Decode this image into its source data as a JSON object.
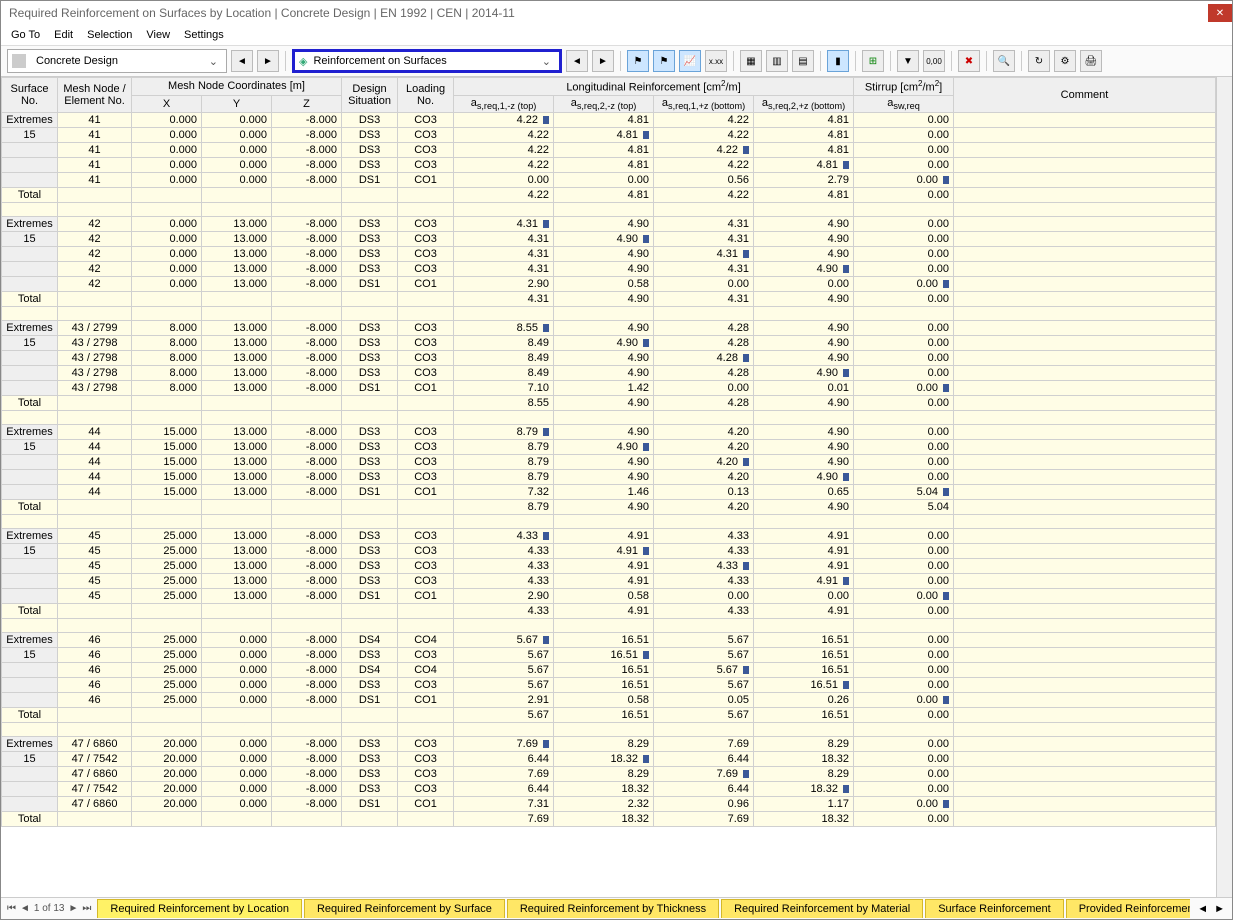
{
  "title": "Required Reinforcement on Surfaces by Location | Concrete Design | EN 1992 | CEN | 2014-11",
  "menu": [
    "Go To",
    "Edit",
    "Selection",
    "View",
    "Settings"
  ],
  "combo_design": "Concrete Design",
  "combo_reinf": "Reinforcement on Surfaces",
  "headers": {
    "surface_no": "Surface\nNo.",
    "mesh_node": "Mesh Node /\nElement No.",
    "coords": "Mesh Node Coordinates [m]",
    "x": "X",
    "y": "Y",
    "z": "Z",
    "design_sit": "Design\nSituation",
    "loading_no": "Loading\nNo.",
    "long_reinf": "Longitudinal Reinforcement [cm²/m]",
    "c1": "a_s,req,1,-z (top)",
    "c2": "a_s,req,2,-z (top)",
    "c3": "a_s,req,1,+z (bottom)",
    "c4": "a_s,req,2,+z (bottom)",
    "stirrup": "Stirrup [cm²/m²]",
    "sw": "a_sw,req",
    "comment": "Comment"
  },
  "groups": [
    {
      "label1": "Extremes",
      "label2": "15",
      "rows": [
        {
          "mn": "41",
          "x": "0.000",
          "y": "0.000",
          "z": "-8.000",
          "ds": "DS3",
          "ln": "CO3",
          "v": [
            "4.22",
            "4.81",
            "4.22",
            "4.81",
            "0.00"
          ],
          "m": [
            1,
            0,
            0,
            0,
            0
          ]
        },
        {
          "mn": "41",
          "x": "0.000",
          "y": "0.000",
          "z": "-8.000",
          "ds": "DS3",
          "ln": "CO3",
          "v": [
            "4.22",
            "4.81",
            "4.22",
            "4.81",
            "0.00"
          ],
          "m": [
            0,
            1,
            0,
            0,
            0
          ]
        },
        {
          "mn": "41",
          "x": "0.000",
          "y": "0.000",
          "z": "-8.000",
          "ds": "DS3",
          "ln": "CO3",
          "v": [
            "4.22",
            "4.81",
            "4.22",
            "4.81",
            "0.00"
          ],
          "m": [
            0,
            0,
            1,
            0,
            0
          ]
        },
        {
          "mn": "41",
          "x": "0.000",
          "y": "0.000",
          "z": "-8.000",
          "ds": "DS3",
          "ln": "CO3",
          "v": [
            "4.22",
            "4.81",
            "4.22",
            "4.81",
            "0.00"
          ],
          "m": [
            0,
            0,
            0,
            1,
            0
          ]
        },
        {
          "mn": "41",
          "x": "0.000",
          "y": "0.000",
          "z": "-8.000",
          "ds": "DS1",
          "ln": "CO1",
          "v": [
            "0.00",
            "0.00",
            "0.56",
            "2.79",
            "0.00"
          ],
          "m": [
            0,
            0,
            0,
            0,
            1
          ]
        }
      ],
      "total": [
        "4.22",
        "4.81",
        "4.22",
        "4.81",
        "0.00"
      ]
    },
    {
      "label1": "Extremes",
      "label2": "15",
      "rows": [
        {
          "mn": "42",
          "x": "0.000",
          "y": "13.000",
          "z": "-8.000",
          "ds": "DS3",
          "ln": "CO3",
          "v": [
            "4.31",
            "4.90",
            "4.31",
            "4.90",
            "0.00"
          ],
          "m": [
            1,
            0,
            0,
            0,
            0
          ]
        },
        {
          "mn": "42",
          "x": "0.000",
          "y": "13.000",
          "z": "-8.000",
          "ds": "DS3",
          "ln": "CO3",
          "v": [
            "4.31",
            "4.90",
            "4.31",
            "4.90",
            "0.00"
          ],
          "m": [
            0,
            1,
            0,
            0,
            0
          ]
        },
        {
          "mn": "42",
          "x": "0.000",
          "y": "13.000",
          "z": "-8.000",
          "ds": "DS3",
          "ln": "CO3",
          "v": [
            "4.31",
            "4.90",
            "4.31",
            "4.90",
            "0.00"
          ],
          "m": [
            0,
            0,
            1,
            0,
            0
          ]
        },
        {
          "mn": "42",
          "x": "0.000",
          "y": "13.000",
          "z": "-8.000",
          "ds": "DS3",
          "ln": "CO3",
          "v": [
            "4.31",
            "4.90",
            "4.31",
            "4.90",
            "0.00"
          ],
          "m": [
            0,
            0,
            0,
            1,
            0
          ]
        },
        {
          "mn": "42",
          "x": "0.000",
          "y": "13.000",
          "z": "-8.000",
          "ds": "DS1",
          "ln": "CO1",
          "v": [
            "2.90",
            "0.58",
            "0.00",
            "0.00",
            "0.00"
          ],
          "m": [
            0,
            0,
            0,
            0,
            1
          ]
        }
      ],
      "total": [
        "4.31",
        "4.90",
        "4.31",
        "4.90",
        "0.00"
      ]
    },
    {
      "label1": "Extremes",
      "label2": "15",
      "rows": [
        {
          "mn": "43 / 2799",
          "x": "8.000",
          "y": "13.000",
          "z": "-8.000",
          "ds": "DS3",
          "ln": "CO3",
          "v": [
            "8.55",
            "4.90",
            "4.28",
            "4.90",
            "0.00"
          ],
          "m": [
            1,
            0,
            0,
            0,
            0
          ]
        },
        {
          "mn": "43 / 2798",
          "x": "8.000",
          "y": "13.000",
          "z": "-8.000",
          "ds": "DS3",
          "ln": "CO3",
          "v": [
            "8.49",
            "4.90",
            "4.28",
            "4.90",
            "0.00"
          ],
          "m": [
            0,
            1,
            0,
            0,
            0
          ]
        },
        {
          "mn": "43 / 2798",
          "x": "8.000",
          "y": "13.000",
          "z": "-8.000",
          "ds": "DS3",
          "ln": "CO3",
          "v": [
            "8.49",
            "4.90",
            "4.28",
            "4.90",
            "0.00"
          ],
          "m": [
            0,
            0,
            1,
            0,
            0
          ]
        },
        {
          "mn": "43 / 2798",
          "x": "8.000",
          "y": "13.000",
          "z": "-8.000",
          "ds": "DS3",
          "ln": "CO3",
          "v": [
            "8.49",
            "4.90",
            "4.28",
            "4.90",
            "0.00"
          ],
          "m": [
            0,
            0,
            0,
            1,
            0
          ]
        },
        {
          "mn": "43 / 2798",
          "x": "8.000",
          "y": "13.000",
          "z": "-8.000",
          "ds": "DS1",
          "ln": "CO1",
          "v": [
            "7.10",
            "1.42",
            "0.00",
            "0.01",
            "0.00"
          ],
          "m": [
            0,
            0,
            0,
            0,
            1
          ]
        }
      ],
      "total": [
        "8.55",
        "4.90",
        "4.28",
        "4.90",
        "0.00"
      ]
    },
    {
      "label1": "Extremes",
      "label2": "15",
      "rows": [
        {
          "mn": "44",
          "x": "15.000",
          "y": "13.000",
          "z": "-8.000",
          "ds": "DS3",
          "ln": "CO3",
          "v": [
            "8.79",
            "4.90",
            "4.20",
            "4.90",
            "0.00"
          ],
          "m": [
            1,
            0,
            0,
            0,
            0
          ]
        },
        {
          "mn": "44",
          "x": "15.000",
          "y": "13.000",
          "z": "-8.000",
          "ds": "DS3",
          "ln": "CO3",
          "v": [
            "8.79",
            "4.90",
            "4.20",
            "4.90",
            "0.00"
          ],
          "m": [
            0,
            1,
            0,
            0,
            0
          ]
        },
        {
          "mn": "44",
          "x": "15.000",
          "y": "13.000",
          "z": "-8.000",
          "ds": "DS3",
          "ln": "CO3",
          "v": [
            "8.79",
            "4.90",
            "4.20",
            "4.90",
            "0.00"
          ],
          "m": [
            0,
            0,
            1,
            0,
            0
          ]
        },
        {
          "mn": "44",
          "x": "15.000",
          "y": "13.000",
          "z": "-8.000",
          "ds": "DS3",
          "ln": "CO3",
          "v": [
            "8.79",
            "4.90",
            "4.20",
            "4.90",
            "0.00"
          ],
          "m": [
            0,
            0,
            0,
            1,
            0
          ]
        },
        {
          "mn": "44",
          "x": "15.000",
          "y": "13.000",
          "z": "-8.000",
          "ds": "DS1",
          "ln": "CO1",
          "v": [
            "7.32",
            "1.46",
            "0.13",
            "0.65",
            "5.04"
          ],
          "m": [
            0,
            0,
            0,
            0,
            1
          ]
        }
      ],
      "total": [
        "8.79",
        "4.90",
        "4.20",
        "4.90",
        "5.04"
      ]
    },
    {
      "label1": "Extremes",
      "label2": "15",
      "rows": [
        {
          "mn": "45",
          "x": "25.000",
          "y": "13.000",
          "z": "-8.000",
          "ds": "DS3",
          "ln": "CO3",
          "v": [
            "4.33",
            "4.91",
            "4.33",
            "4.91",
            "0.00"
          ],
          "m": [
            1,
            0,
            0,
            0,
            0
          ]
        },
        {
          "mn": "45",
          "x": "25.000",
          "y": "13.000",
          "z": "-8.000",
          "ds": "DS3",
          "ln": "CO3",
          "v": [
            "4.33",
            "4.91",
            "4.33",
            "4.91",
            "0.00"
          ],
          "m": [
            0,
            1,
            0,
            0,
            0
          ]
        },
        {
          "mn": "45",
          "x": "25.000",
          "y": "13.000",
          "z": "-8.000",
          "ds": "DS3",
          "ln": "CO3",
          "v": [
            "4.33",
            "4.91",
            "4.33",
            "4.91",
            "0.00"
          ],
          "m": [
            0,
            0,
            1,
            0,
            0
          ]
        },
        {
          "mn": "45",
          "x": "25.000",
          "y": "13.000",
          "z": "-8.000",
          "ds": "DS3",
          "ln": "CO3",
          "v": [
            "4.33",
            "4.91",
            "4.33",
            "4.91",
            "0.00"
          ],
          "m": [
            0,
            0,
            0,
            1,
            0
          ]
        },
        {
          "mn": "45",
          "x": "25.000",
          "y": "13.000",
          "z": "-8.000",
          "ds": "DS1",
          "ln": "CO1",
          "v": [
            "2.90",
            "0.58",
            "0.00",
            "0.00",
            "0.00"
          ],
          "m": [
            0,
            0,
            0,
            0,
            1
          ]
        }
      ],
      "total": [
        "4.33",
        "4.91",
        "4.33",
        "4.91",
        "0.00"
      ]
    },
    {
      "label1": "Extremes",
      "label2": "15",
      "rows": [
        {
          "mn": "46",
          "x": "25.000",
          "y": "0.000",
          "z": "-8.000",
          "ds": "DS4",
          "ln": "CO4",
          "v": [
            "5.67",
            "16.51",
            "5.67",
            "16.51",
            "0.00"
          ],
          "m": [
            1,
            0,
            0,
            0,
            0
          ]
        },
        {
          "mn": "46",
          "x": "25.000",
          "y": "0.000",
          "z": "-8.000",
          "ds": "DS3",
          "ln": "CO3",
          "v": [
            "5.67",
            "16.51",
            "5.67",
            "16.51",
            "0.00"
          ],
          "m": [
            0,
            1,
            0,
            0,
            0
          ]
        },
        {
          "mn": "46",
          "x": "25.000",
          "y": "0.000",
          "z": "-8.000",
          "ds": "DS4",
          "ln": "CO4",
          "v": [
            "5.67",
            "16.51",
            "5.67",
            "16.51",
            "0.00"
          ],
          "m": [
            0,
            0,
            1,
            0,
            0
          ]
        },
        {
          "mn": "46",
          "x": "25.000",
          "y": "0.000",
          "z": "-8.000",
          "ds": "DS3",
          "ln": "CO3",
          "v": [
            "5.67",
            "16.51",
            "5.67",
            "16.51",
            "0.00"
          ],
          "m": [
            0,
            0,
            0,
            1,
            0
          ]
        },
        {
          "mn": "46",
          "x": "25.000",
          "y": "0.000",
          "z": "-8.000",
          "ds": "DS1",
          "ln": "CO1",
          "v": [
            "2.91",
            "0.58",
            "0.05",
            "0.26",
            "0.00"
          ],
          "m": [
            0,
            0,
            0,
            0,
            1
          ]
        }
      ],
      "total": [
        "5.67",
        "16.51",
        "5.67",
        "16.51",
        "0.00"
      ]
    },
    {
      "label1": "Extremes",
      "label2": "15",
      "rows": [
        {
          "mn": "47 / 6860",
          "x": "20.000",
          "y": "0.000",
          "z": "-8.000",
          "ds": "DS3",
          "ln": "CO3",
          "v": [
            "7.69",
            "8.29",
            "7.69",
            "8.29",
            "0.00"
          ],
          "m": [
            1,
            0,
            0,
            0,
            0
          ]
        },
        {
          "mn": "47 / 7542",
          "x": "20.000",
          "y": "0.000",
          "z": "-8.000",
          "ds": "DS3",
          "ln": "CO3",
          "v": [
            "6.44",
            "18.32",
            "6.44",
            "18.32",
            "0.00"
          ],
          "m": [
            0,
            1,
            0,
            0,
            0
          ]
        },
        {
          "mn": "47 / 6860",
          "x": "20.000",
          "y": "0.000",
          "z": "-8.000",
          "ds": "DS3",
          "ln": "CO3",
          "v": [
            "7.69",
            "8.29",
            "7.69",
            "8.29",
            "0.00"
          ],
          "m": [
            0,
            0,
            1,
            0,
            0
          ]
        },
        {
          "mn": "47 / 7542",
          "x": "20.000",
          "y": "0.000",
          "z": "-8.000",
          "ds": "DS3",
          "ln": "CO3",
          "v": [
            "6.44",
            "18.32",
            "6.44",
            "18.32",
            "0.00"
          ],
          "m": [
            0,
            0,
            0,
            1,
            0
          ]
        },
        {
          "mn": "47 / 6860",
          "x": "20.000",
          "y": "0.000",
          "z": "-8.000",
          "ds": "DS1",
          "ln": "CO1",
          "v": [
            "7.31",
            "2.32",
            "0.96",
            "1.17",
            "0.00"
          ],
          "m": [
            0,
            0,
            0,
            0,
            1
          ]
        }
      ],
      "total": [
        "7.69",
        "18.32",
        "7.69",
        "18.32",
        "0.00"
      ]
    }
  ],
  "total_label": "Total",
  "footer": {
    "page": "1 of 13",
    "tabs": [
      "Required Reinforcement by Location",
      "Required Reinforcement by Surface",
      "Required Reinforcement by Thickness",
      "Required Reinforcement by Material",
      "Surface Reinforcement",
      "Provided Reinforcement"
    ]
  }
}
